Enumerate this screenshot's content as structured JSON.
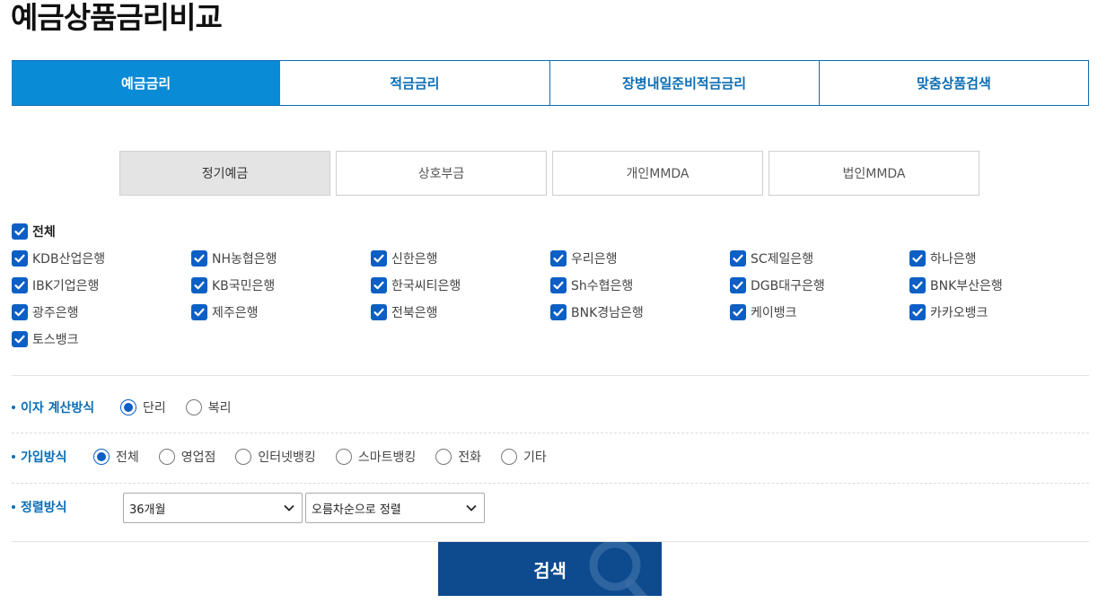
{
  "page_title": "예금상품금리비교",
  "main_tabs": [
    {
      "label": "예금금리",
      "active": true
    },
    {
      "label": "적금금리",
      "active": false
    },
    {
      "label": "장병내일준비적금금리",
      "active": false
    },
    {
      "label": "맞춤상품검색",
      "active": false
    }
  ],
  "sub_tabs": [
    {
      "label": "정기예금",
      "active": true
    },
    {
      "label": "상호부금",
      "active": false
    },
    {
      "label": "개인MMDA",
      "active": false
    },
    {
      "label": "법인MMDA",
      "active": false
    }
  ],
  "all_checkbox": {
    "label": "전체",
    "checked": true
  },
  "banks": [
    {
      "label": "KDB산업은행",
      "checked": true
    },
    {
      "label": "NH농협은행",
      "checked": true
    },
    {
      "label": "신한은행",
      "checked": true
    },
    {
      "label": "우리은행",
      "checked": true
    },
    {
      "label": "SC제일은행",
      "checked": true
    },
    {
      "label": "하나은행",
      "checked": true
    },
    {
      "label": "IBK기업은행",
      "checked": true
    },
    {
      "label": "KB국민은행",
      "checked": true
    },
    {
      "label": "한국씨티은행",
      "checked": true
    },
    {
      "label": "Sh수협은행",
      "checked": true
    },
    {
      "label": "DGB대구은행",
      "checked": true
    },
    {
      "label": "BNK부산은행",
      "checked": true
    },
    {
      "label": "광주은행",
      "checked": true
    },
    {
      "label": "제주은행",
      "checked": true
    },
    {
      "label": "전북은행",
      "checked": true
    },
    {
      "label": "BNK경남은행",
      "checked": true
    },
    {
      "label": "케이뱅크",
      "checked": true
    },
    {
      "label": "카카오뱅크",
      "checked": true
    },
    {
      "label": "토스뱅크",
      "checked": true
    }
  ],
  "interest_method": {
    "label": "이자 계산방식",
    "options": [
      {
        "label": "단리",
        "selected": true
      },
      {
        "label": "복리",
        "selected": false
      }
    ]
  },
  "join_method": {
    "label": "가입방식",
    "options": [
      {
        "label": "전체",
        "selected": true
      },
      {
        "label": "영업점",
        "selected": false
      },
      {
        "label": "인터넷뱅킹",
        "selected": false
      },
      {
        "label": "스마트뱅킹",
        "selected": false
      },
      {
        "label": "전화",
        "selected": false
      },
      {
        "label": "기타",
        "selected": false
      }
    ]
  },
  "sort_method": {
    "label": "정렬방식",
    "period_value": "36개월",
    "order_value": "오름차순으로 정렬"
  },
  "search_button": {
    "label": "검색"
  },
  "colors": {
    "accent": "#0a8bd6",
    "primary_text": "#0a6db5",
    "checkbox": "#0b5fc5",
    "button": "#0d4a8e"
  }
}
